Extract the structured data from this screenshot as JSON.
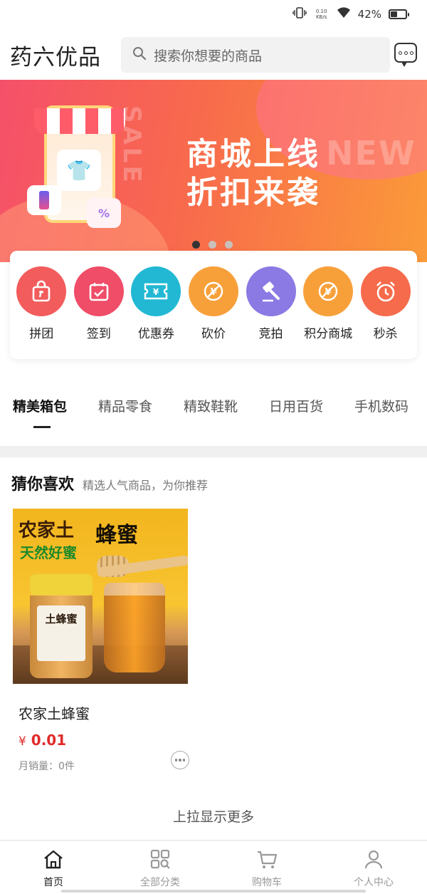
{
  "status_bar": {
    "net_speed_value": "0.10",
    "net_speed_unit": "KB/s",
    "battery": "42%"
  },
  "header": {
    "app_title": "药六优品",
    "search_placeholder": "搜索你想要的商品"
  },
  "banner": {
    "line1": "商城上线",
    "line2": "折扣来袭",
    "ghost_text": "NEW",
    "vertical_text": "SALE",
    "slides": 3,
    "active_slide": 1,
    "gradient_colors": [
      "#f5506a",
      "#fb9b39"
    ]
  },
  "quick_menu": [
    {
      "label": "拼团",
      "icon": "shopping-bag-icon",
      "color": "#f25c5c"
    },
    {
      "label": "签到",
      "icon": "calendar-check-icon",
      "color": "#ef4d68"
    },
    {
      "label": "优惠券",
      "icon": "coupon-icon",
      "color": "#22b8d4"
    },
    {
      "label": "砍价",
      "icon": "price-cut-icon",
      "color": "#f7a03a"
    },
    {
      "label": "竞拍",
      "icon": "auction-hammer-icon",
      "color": "#8b79e4"
    },
    {
      "label": "积分商城",
      "icon": "points-icon",
      "color": "#f7a03a"
    },
    {
      "label": "秒杀",
      "icon": "alarm-clock-icon",
      "color": "#f56b4c"
    }
  ],
  "category_tabs": [
    {
      "label": "精美箱包",
      "active": true
    },
    {
      "label": "精品零食",
      "active": false
    },
    {
      "label": "精致鞋靴",
      "active": false
    },
    {
      "label": "日用百货",
      "active": false
    },
    {
      "label": "手机数码",
      "active": false
    }
  ],
  "recommend": {
    "title": "猜你喜欢",
    "subtitle": "精选人气商品，为你推荐"
  },
  "product": {
    "image_text1": "农家土",
    "image_text2": "天然好蜜",
    "image_text3": "蜂蜜",
    "jar_label": "土蜂蜜",
    "name": "农家土蜂蜜",
    "currency": "¥",
    "price": "0.01",
    "sales": "月销量：0件"
  },
  "load_more": "上拉显示更多",
  "tab_bar": [
    {
      "label": "首页",
      "icon": "home-icon",
      "active": true
    },
    {
      "label": "全部分类",
      "icon": "category-grid-icon",
      "active": false
    },
    {
      "label": "购物车",
      "icon": "cart-icon",
      "active": false
    },
    {
      "label": "个人中心",
      "icon": "user-icon",
      "active": false
    }
  ]
}
